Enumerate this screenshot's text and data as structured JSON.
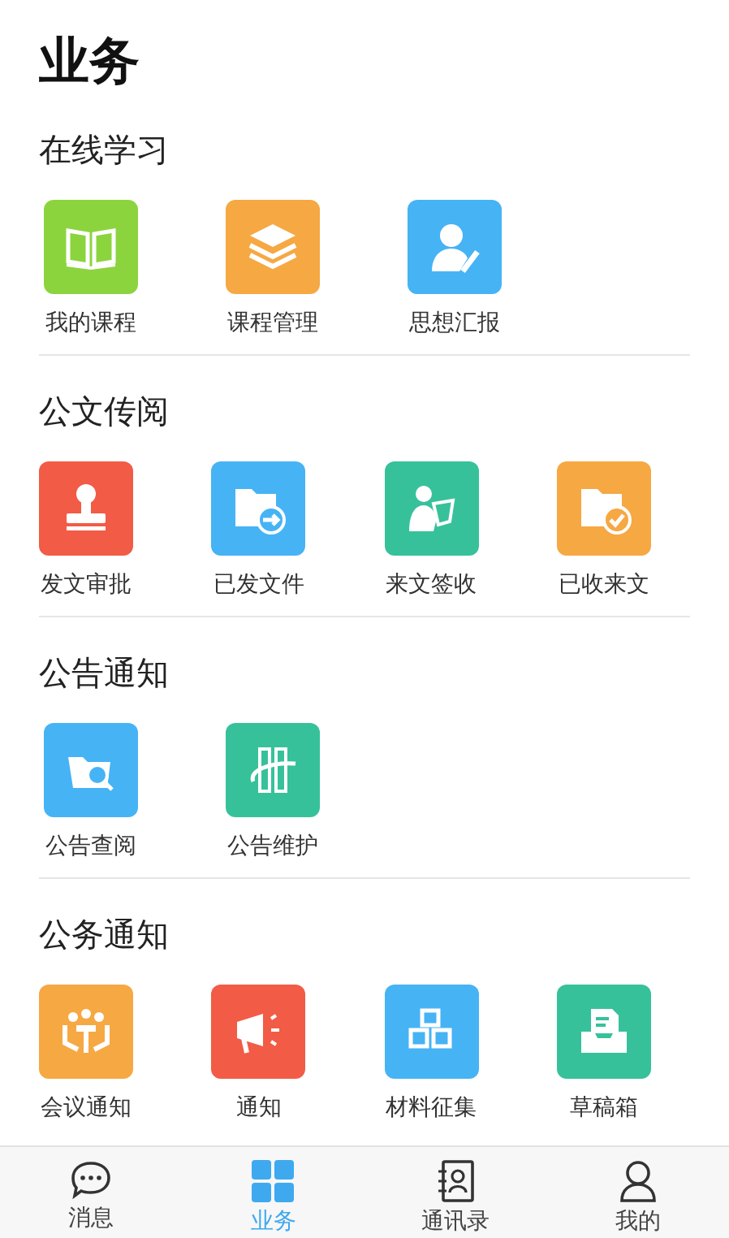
{
  "title": "业务",
  "sections": [
    {
      "title": "在线学习",
      "items": [
        {
          "label": "我的课程",
          "color": "#8cd43e"
        },
        {
          "label": "课程管理",
          "color": "#f6a843"
        },
        {
          "label": "思想汇报",
          "color": "#46b3f5"
        }
      ]
    },
    {
      "title": "公文传阅",
      "items": [
        {
          "label": "发文审批",
          "color": "#f25b45"
        },
        {
          "label": "已发文件",
          "color": "#46b3f5"
        },
        {
          "label": "来文签收",
          "color": "#37c19b"
        },
        {
          "label": "已收来文",
          "color": "#f6a843"
        }
      ]
    },
    {
      "title": "公告通知",
      "items": [
        {
          "label": "公告查阅",
          "color": "#46b3f5"
        },
        {
          "label": "公告维护",
          "color": "#37c19b"
        }
      ]
    },
    {
      "title": "公务通知",
      "items": [
        {
          "label": "会议通知",
          "color": "#f6a843"
        },
        {
          "label": "通知",
          "color": "#f25b45"
        },
        {
          "label": "材料征集",
          "color": "#46b3f5"
        },
        {
          "label": "草稿箱",
          "color": "#37c19b"
        }
      ]
    }
  ],
  "tabs": [
    {
      "label": "消息",
      "selected": false
    },
    {
      "label": "业务",
      "selected": true
    },
    {
      "label": "通讯录",
      "selected": false
    },
    {
      "label": "我的",
      "selected": false
    }
  ]
}
